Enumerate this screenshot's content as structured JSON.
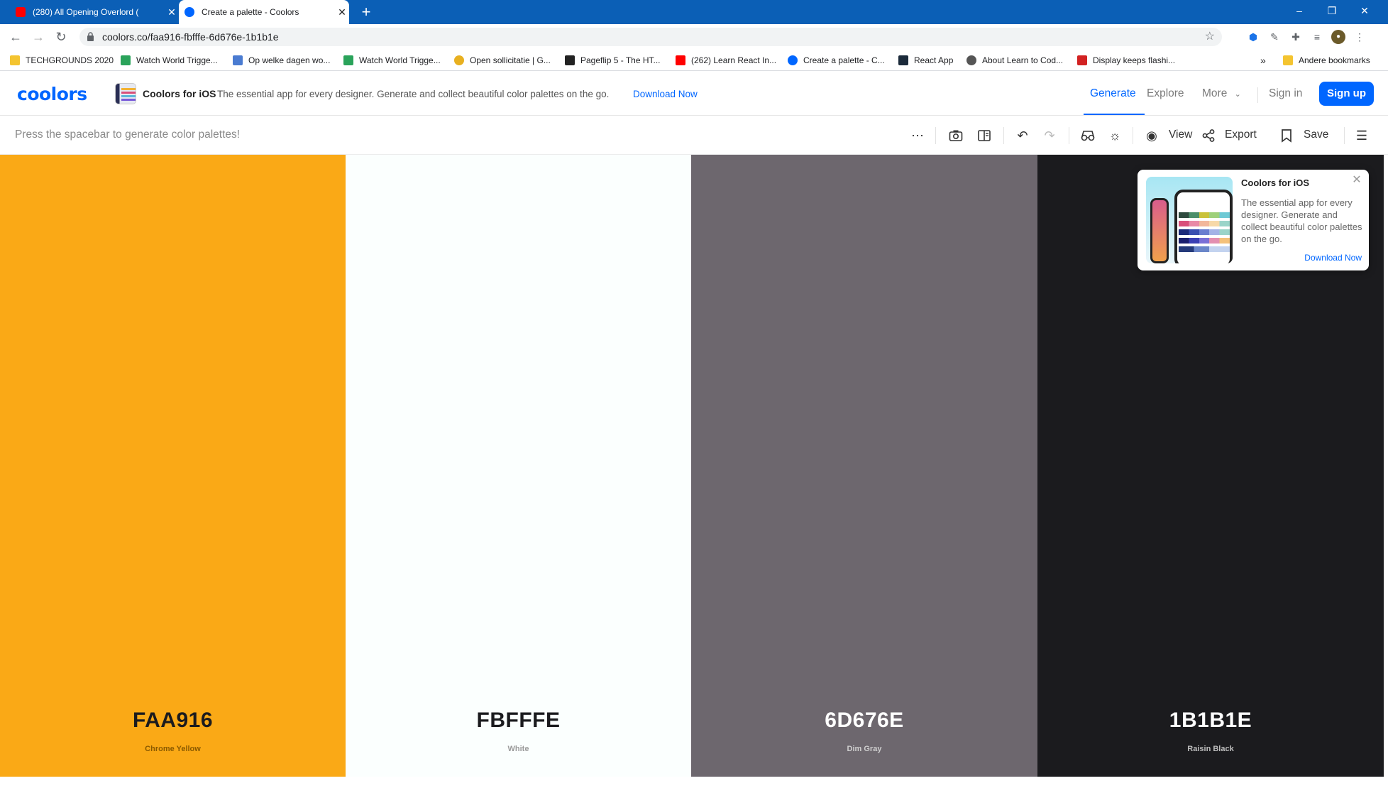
{
  "browser": {
    "tabs": [
      {
        "title": "(280) All Opening Overlord (",
        "favicon_color": "#ff0000"
      },
      {
        "title": "Create a palette - Coolors",
        "favicon_color": "#0066ff"
      }
    ],
    "new_tab": "+",
    "url": "coolors.co/faa916-fbfffe-6d676e-1b1b1e",
    "window_controls": [
      "–",
      "❐",
      "✕"
    ],
    "bookmarks": [
      {
        "label": "TECHGROUNDS 2020",
        "icon_color": "#f4c430"
      },
      {
        "label": "Watch World Trigge...",
        "icon_color": "#2aa35a"
      },
      {
        "label": "Op welke dagen wo...",
        "icon_color": "#4a7bd1"
      },
      {
        "label": "Watch World Trigge...",
        "icon_color": "#2aa35a"
      },
      {
        "label": "Open sollicitatie | G...",
        "icon_color": "#e8b020"
      },
      {
        "label": "Pageflip 5 - The HT...",
        "icon_color": "#222222"
      },
      {
        "label": "(262) Learn React In...",
        "icon_color": "#ff0000"
      },
      {
        "label": "Create a palette - C...",
        "icon_color": "#0066ff"
      },
      {
        "label": "React App",
        "icon_color": "#1b2a3a"
      },
      {
        "label": "About Learn to Cod...",
        "icon_color": "#555555"
      },
      {
        "label": "Display keeps flashi...",
        "icon_color": "#d22222"
      }
    ],
    "bookmarks_overflow": "»",
    "other_bookmarks": "Andere bookmarks"
  },
  "header": {
    "logo": "coolors",
    "promo_title": "Coolors for iOS",
    "promo_text": "The essential app for every designer. Generate and collect beautiful color palettes on the go.",
    "promo_link": "Download Now",
    "nav": [
      "Generate",
      "Explore",
      "More"
    ],
    "signin": "Sign in",
    "signup": "Sign up"
  },
  "toolbar": {
    "hint": "Press the spacebar to generate color palettes!",
    "view_label": "View",
    "export_label": "Export",
    "save_label": "Save"
  },
  "palette": [
    {
      "hex": "FAA916",
      "name": "Chrome Yellow",
      "color": "#FAA916",
      "text_color": "#1b1b1e",
      "name_color": "#8a5a00"
    },
    {
      "hex": "FBFFFE",
      "name": "White",
      "color": "#FBFFFE",
      "text_color": "#1b1b1e",
      "name_color": "#9a9a9a"
    },
    {
      "hex": "6D676E",
      "name": "Dim Gray",
      "color": "#6D676E",
      "text_color": "#ffffff",
      "name_color": "#cfcfcf"
    },
    {
      "hex": "1B1B1E",
      "name": "Raisin Black",
      "color": "#1B1B1E",
      "text_color": "#ffffff",
      "name_color": "#bdbdbd"
    }
  ],
  "ios_card": {
    "title": "Coolors for iOS",
    "body": "The essential app for every designer. Generate and collect beautiful color palettes on the go.",
    "link": "Download Now"
  },
  "colors": {
    "accent": "#0066ff",
    "chrome_blue": "#0b5fb6"
  }
}
